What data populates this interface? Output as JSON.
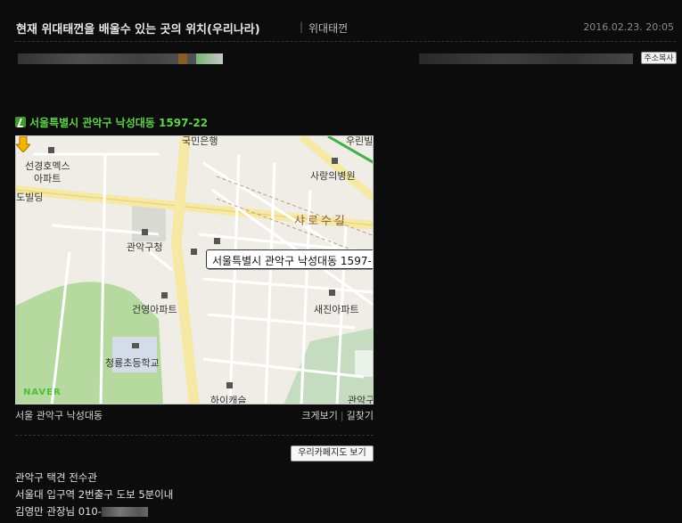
{
  "post": {
    "title": "현재 위대태껀을 배울수 있는 곳의 위치(우리나라)",
    "separator": "|",
    "category": "위대태껀",
    "date": "2016.02.23. 20:05"
  },
  "actions": {
    "copy_address_label": "주소복사",
    "cafe_map_label": "우리카페지도 보기"
  },
  "map_block": {
    "heading": "서울특별시 관악구 낙성대동 1597-22",
    "callout": "서울특별시 관악구 낙성대동 1597-",
    "caption": "서울 관악구 낙성대동",
    "link_enlarge": "크게보기",
    "link_separator": "|",
    "link_directions": "길찾기",
    "provider": "NAVER",
    "labels": {
      "bank": "국민은행",
      "building_top": "우린빌",
      "apt_a1": "선경호멕스",
      "apt_a2": "아파트",
      "building_left": "도빌딩",
      "hospital": "사랑의병원",
      "street": "샤로수길",
      "gu_office": "관악구청",
      "apt_b": "건영아파트",
      "apt_c": "새진아파트",
      "school": "청룡초등학교",
      "bottom": "하이캐슬",
      "bottom_right": "관악구"
    },
    "colors": {
      "heading": "#5fd14b",
      "road": "#f6e9a5",
      "park": "#b6d9a0"
    }
  },
  "body": {
    "line1": "관악구 택견 전수관",
    "line2": "서울대 입구역 2번출구 도보 5분이내",
    "line3_prefix": "김영만 관장님 010-"
  }
}
